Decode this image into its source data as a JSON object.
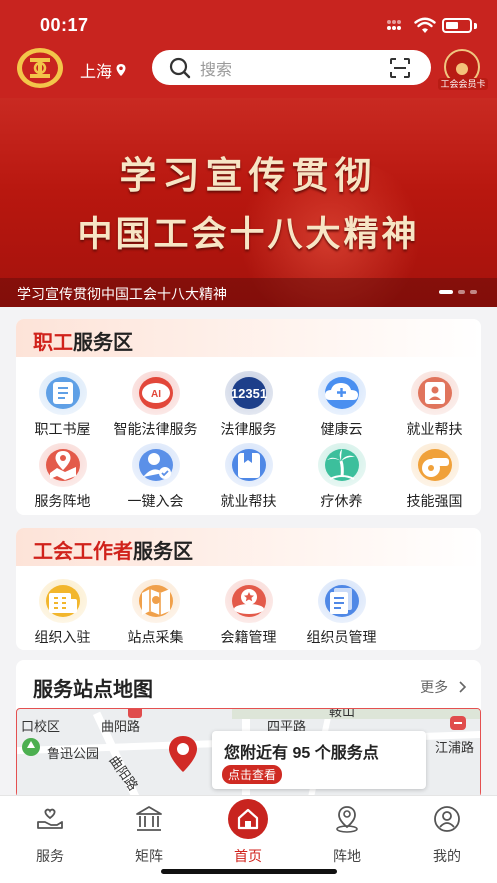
{
  "status_bar": {
    "time": "00:17"
  },
  "header": {
    "city": "上海",
    "search_placeholder": "搜索",
    "member_card_label": "工会会员卡"
  },
  "banner": {
    "headline_line1": "学习宣传贯彻",
    "headline_line2": "中国工会十八大精神",
    "caption": "学习宣传贯彻中国工会十八大精神",
    "page_index": 1,
    "page_count": 3
  },
  "staff_section": {
    "title_red": "职工",
    "title_rest": "服务区",
    "items": [
      {
        "label": "职工书屋",
        "icon": "book-icon",
        "color": "#5fa0e6"
      },
      {
        "label": "智能法律服务",
        "icon": "ai-legal-icon",
        "color": "#e2473a"
      },
      {
        "label": "法律服务",
        "icon": "hotline-12351-icon",
        "color": "#1d3f8a"
      },
      {
        "label": "健康云",
        "icon": "cloud-plus-icon",
        "color": "#4a8ff0"
      },
      {
        "label": "就业帮扶",
        "icon": "resume-icon",
        "color": "#e0745c"
      },
      {
        "label": "服务阵地",
        "icon": "map-pin-icon",
        "color": "#e35a4a"
      },
      {
        "label": "一键入会",
        "icon": "person-check-icon",
        "color": "#5b90e8"
      },
      {
        "label": "就业帮扶",
        "icon": "bookmark-book-icon",
        "color": "#4f88e6"
      },
      {
        "label": "疗休养",
        "icon": "palm-tree-icon",
        "color": "#3cbf9c"
      },
      {
        "label": "技能强国",
        "icon": "whistle-icon",
        "color": "#f0a13a"
      }
    ]
  },
  "worker_section": {
    "title_red": "工会工作者",
    "title_rest": "服务区",
    "items": [
      {
        "label": "组织入驻",
        "icon": "building-icon",
        "color": "#f2b62c"
      },
      {
        "label": "站点采集",
        "icon": "folded-map-icon",
        "color": "#f0a04a"
      },
      {
        "label": "会籍管理",
        "icon": "member-badge-icon",
        "color": "#e35a4a"
      },
      {
        "label": "组织员管理",
        "icon": "document-stack-icon",
        "color": "#4f88e6"
      }
    ]
  },
  "map_section": {
    "title": "服务站点地图",
    "more": "更多",
    "popup_text": "您附近有 95 个服务点",
    "popup_button": "点击查看",
    "labels": [
      "口校区",
      "曲阳路",
      "鲁迅公园",
      "曲阳路",
      "四平路",
      "江浦路",
      "鞍山"
    ]
  },
  "tabbar": {
    "items": [
      {
        "label": "服务",
        "icon": "hand-heart-icon"
      },
      {
        "label": "矩阵",
        "icon": "bank-icon"
      },
      {
        "label": "首页",
        "icon": "home-icon",
        "active": true
      },
      {
        "label": "阵地",
        "icon": "location-person-icon"
      },
      {
        "label": "我的",
        "icon": "user-icon"
      }
    ]
  }
}
